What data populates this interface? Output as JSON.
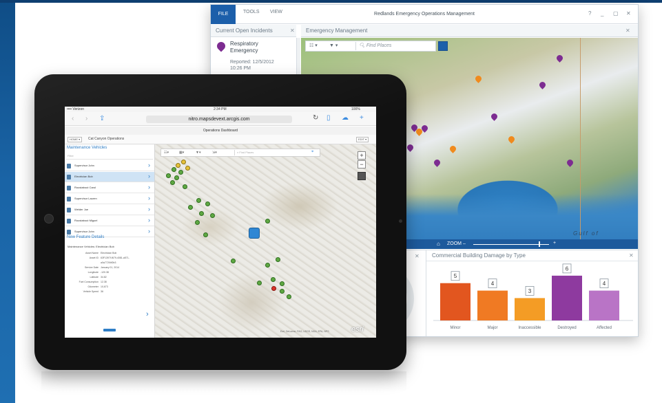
{
  "desktop": {
    "menu": {
      "file": "FILE",
      "tools": "TOOLS",
      "view": "VIEW"
    },
    "title": "Redlands Emergency Operations Management",
    "controls": {
      "help": "?",
      "minimize": "_",
      "restore": "▢",
      "close": "✕"
    },
    "incidents_panel": {
      "title": "Current Open Incidents",
      "close": "✕",
      "incident": {
        "line1": "Respiratory",
        "line2": "Emergency",
        "reported": "Reported: 12/5/2012",
        "time": "10:26 PM"
      }
    },
    "map_panel": {
      "title": "Emergency Management",
      "close": "✕",
      "search_placeholder": "Find Places",
      "gulf_label": "Gulf of",
      "zoom_label": "ZOOM –",
      "zoom_plus": "+",
      "zoom_level": 0.86
    },
    "lower_left_close": "✕",
    "chart_panel": {
      "title": "Commercial Building Damage by Type",
      "close": "✕"
    }
  },
  "chart_data": {
    "type": "bar",
    "title": "Commercial Building Damage by Type",
    "categories": [
      "Minor",
      "Major",
      "Inaccessible",
      "Destroyed",
      "Affected"
    ],
    "values": [
      5,
      4,
      3,
      6,
      4
    ],
    "colors": [
      "#e2561f",
      "#f07a23",
      "#f49c25",
      "#8e3a9f",
      "#b974c6"
    ],
    "ylim": [
      0,
      7
    ]
  },
  "tablet": {
    "status": {
      "carrier": "•••• Verizon",
      "time": "2:34 PM",
      "battery": "100%"
    },
    "browser": {
      "url": "nitro.mapsdevext.arcgis.com"
    },
    "dashboard": {
      "title": "Operations Dashboard",
      "home": "HOME ▾",
      "operation": "Cat Canyon Operations",
      "edit": "EDIT ▾"
    },
    "vehicles": {
      "title": "Maintenance Vehicles",
      "filter_placeholder": "Filter",
      "items": [
        "Supervisor John",
        "Electrician Bob",
        "Roustabout Carol",
        "Supervisor Lauren",
        "Welder Joe",
        "Roustabout Miguel",
        "Supervisor John"
      ],
      "selected_index": 1
    },
    "feature": {
      "title": "New Feature Details",
      "subtitle": "Maintenance Vehicles: Electrician Bob",
      "rows": [
        {
          "k": "Asset Name",
          "v": "Electrician Bob"
        },
        {
          "k": "Asset ID",
          "v": "63F1397f-f679-4081-a571-"
        },
        {
          "k": "",
          "v": "a0a77294f0b3"
        },
        {
          "k": "Service Date",
          "v": "January 01, 2014"
        },
        {
          "k": "Longitude",
          "v": "-120.38"
        },
        {
          "k": "Latitude",
          "v": "34.82"
        },
        {
          "k": "Fuel Consumption",
          "v": "12.38"
        },
        {
          "k": "Odometer",
          "v": "10,673"
        },
        {
          "k": "Vehicle Speed",
          "v": "36"
        }
      ]
    },
    "map": {
      "search_placeholder": "Find Places",
      "credit": "Esri, DeLorme, FAO, USGS, NGA, EPA, NPS",
      "logo": "esri",
      "zoom_in": "+",
      "zoom_out": "−"
    }
  }
}
